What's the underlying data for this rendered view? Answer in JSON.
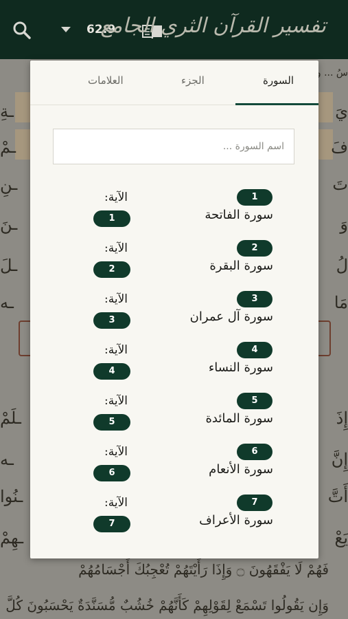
{
  "header": {
    "title_logo": "تفسير القرآن الثري الجامع",
    "verse_ref": "62:9",
    "icons": {
      "search": "search-icon",
      "dropdown": "caret-down-icon",
      "book": "book-open-icon"
    }
  },
  "background": {
    "top_word": "سُ ... ون",
    "lines": [
      "يَ",
      "فَ",
      "تَ",
      "وَ",
      "لُ",
      "مَا",
      "إِذَ",
      "إِنَّ",
      "أَتَّ",
      "يَعْ"
    ],
    "bottom_line_1": "فَهُمْ لَا يَفْقَهُونَ ۝ وَإِذَا رَأَيْتَهُمْ تُعْجِبُكَ أَجْسَامُهُمْ",
    "bottom_line_2": "وَإِن يَقُولُوا تَسْمَعْ لِقَوْلِهِمْ كَأَنَّهُمْ خُشُبٌ مُّسَنَّدَةٌ يَحْسَبُونَ كُلَّ"
  },
  "dialog": {
    "tabs": [
      "السورة",
      "الجزء",
      "العلامات"
    ],
    "active_tab": 0,
    "search_placeholder": "اسم السورة ...",
    "aya_label": "الآية:",
    "items": [
      {
        "number": "1",
        "name": "سورة الفاتحة",
        "aya": "1"
      },
      {
        "number": "2",
        "name": "سورة البقرة",
        "aya": "2"
      },
      {
        "number": "3",
        "name": "سورة آل عمران",
        "aya": "3"
      },
      {
        "number": "4",
        "name": "سورة النساء",
        "aya": "4"
      },
      {
        "number": "5",
        "name": "سورة المائدة",
        "aya": "5"
      },
      {
        "number": "6",
        "name": "سورة الأنعام",
        "aya": "6"
      },
      {
        "number": "7",
        "name": "سورة الأعراف",
        "aya": "7"
      }
    ]
  },
  "colors": {
    "header_bg": "#0f2a1f",
    "pill_bg": "#103a2b",
    "tab_indicator": "#134a3a",
    "dialog_bg": "#f8f7f2"
  }
}
